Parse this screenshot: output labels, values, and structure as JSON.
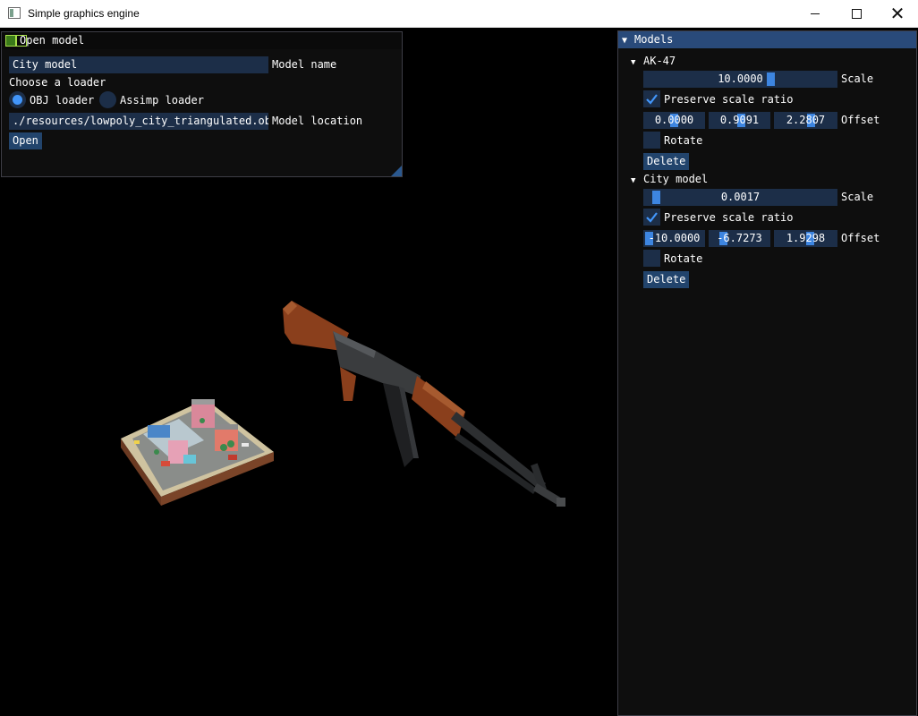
{
  "window": {
    "title": "Simple graphics engine",
    "controls": {
      "minimize": "—",
      "maximize": "☐",
      "close": "✕"
    }
  },
  "open_model": {
    "title": "Open model",
    "model_name_value": "City model",
    "model_name_label": "Model name",
    "loader_prompt": "Choose a loader",
    "loaders": [
      {
        "label": "OBJ loader",
        "selected": true
      },
      {
        "label": "Assimp loader",
        "selected": false
      }
    ],
    "model_location_value": "./resources/lowpoly_city_triangulated.obj",
    "model_location_label": "Model location",
    "open_button": "Open"
  },
  "models_panel": {
    "title": "Models",
    "models": [
      {
        "name": "AK-47",
        "scale": "10.0000",
        "scale_label": "Scale",
        "preserve_label": "Preserve scale ratio",
        "preserve_checked": true,
        "offset": [
          "0.0000",
          "0.9091",
          "2.2807"
        ],
        "offset_label": "Offset",
        "rotate_label": "Rotate",
        "rotate_checked": false,
        "delete_label": "Delete"
      },
      {
        "name": "City model",
        "scale": "0.0017",
        "scale_label": "Scale",
        "preserve_label": "Preserve scale ratio",
        "preserve_checked": true,
        "offset": [
          "-10.0000",
          "-6.7273",
          "1.9298"
        ],
        "offset_label": "Offset",
        "rotate_label": "Rotate",
        "rotate_checked": false,
        "delete_label": "Delete"
      }
    ]
  },
  "colors": {
    "title_active": "#294a7a",
    "frame_bg": "#1d2f4a",
    "slider_grab": "#3d85e0",
    "check_mark": "#4296fa",
    "window_bg": "#0f0f0f"
  }
}
